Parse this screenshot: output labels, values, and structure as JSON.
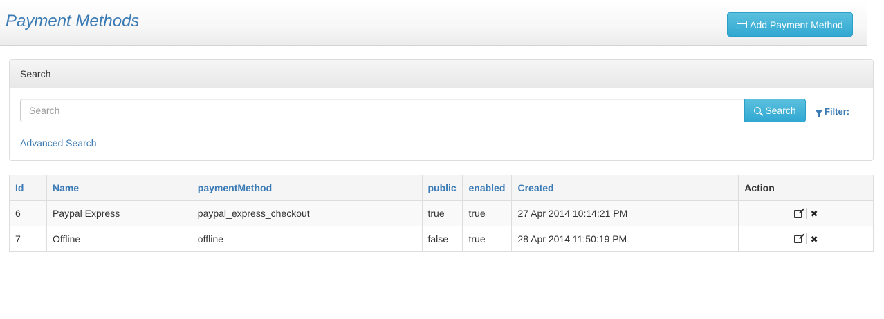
{
  "header": {
    "title": "Payment Methods",
    "add_button_label": "Add Payment Method",
    "add_button_icon": "credit-card-icon"
  },
  "search": {
    "panel_title": "Search",
    "placeholder": "Search",
    "value": "",
    "button_label": "Search",
    "filter_label": "Filter:",
    "advanced_label": "Advanced Search"
  },
  "table": {
    "columns": [
      "Id",
      "Name",
      "paymentMethod",
      "public",
      "enabled",
      "Created",
      "Action"
    ],
    "rows": [
      {
        "id": "6",
        "name": "Paypal Express",
        "payment_method": "paypal_express_checkout",
        "public": "true",
        "enabled": "true",
        "created": "27 Apr 2014 10:14:21 PM"
      },
      {
        "id": "7",
        "name": "Offline",
        "payment_method": "offline",
        "public": "false",
        "enabled": "true",
        "created": "28 Apr 2014 11:50:19 PM"
      }
    ],
    "delete_glyph": "✖"
  },
  "colors": {
    "accent_button": "#5bc0de",
    "link": "#3a7ab5"
  }
}
